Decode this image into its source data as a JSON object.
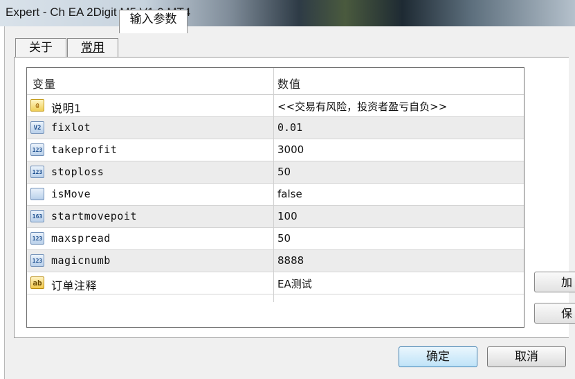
{
  "window": {
    "title": "Expert - Ch EA 2Digit  M5 V1.0 MT4"
  },
  "tabs": [
    {
      "label": "关于",
      "active": false
    },
    {
      "label": "常用",
      "active": false
    },
    {
      "label": "输入参数",
      "active": true
    }
  ],
  "table": {
    "headers": {
      "name": "变量",
      "value": "数值"
    },
    "rows": [
      {
        "icon": "info-icon",
        "icon_text": "@",
        "name": "说明1",
        "value": "<<交易有风险，投资者盈亏自负>>"
      },
      {
        "icon": "variable-icon",
        "icon_text": "V2",
        "name": "fixlot",
        "value": "0.01"
      },
      {
        "icon": "number-icon",
        "icon_text": "123",
        "name": "takeprofit",
        "value": "3000"
      },
      {
        "icon": "number-icon",
        "icon_text": "123",
        "name": "stoploss",
        "value": "50"
      },
      {
        "icon": "number-icon",
        "icon_text": "",
        "name": "isMove",
        "value": "false"
      },
      {
        "icon": "number-icon",
        "icon_text": "163",
        "name": "startmovepoit",
        "value": "100"
      },
      {
        "icon": "number-icon",
        "icon_text": "123",
        "name": "maxspread",
        "value": "50"
      },
      {
        "icon": "number-icon",
        "icon_text": "123",
        "name": "magicnumb",
        "value": "8888"
      },
      {
        "icon": "string-icon",
        "icon_text": "ab",
        "name": "订单注释",
        "value": "EA测试"
      }
    ]
  },
  "side_buttons": {
    "load": "加",
    "save": "保"
  },
  "buttons": {
    "ok": "确定",
    "cancel": "取消"
  }
}
